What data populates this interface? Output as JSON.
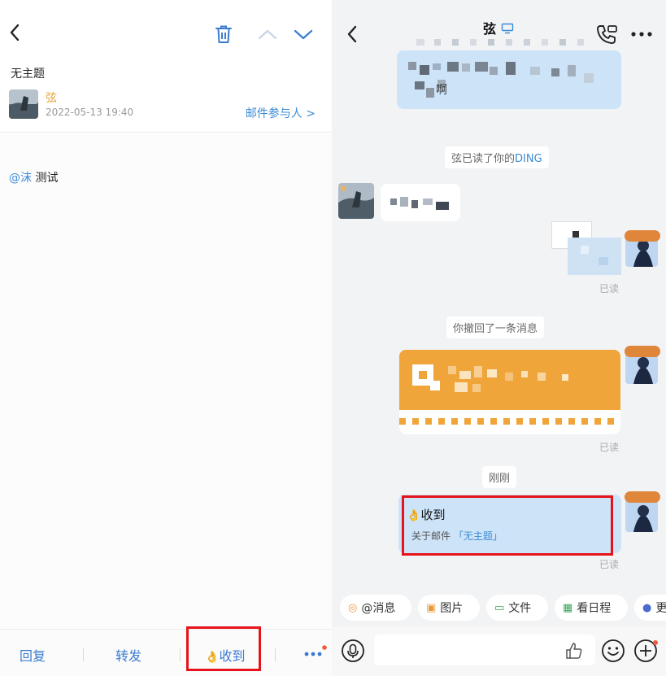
{
  "left": {
    "subject": "无主题",
    "sender": "弦",
    "date": "2022-05-13 19:40",
    "participants_link": "邮件参与人 >",
    "mention": "@沫",
    "mention_text": "测试",
    "bottom": {
      "reply": "回复",
      "forward": "转发",
      "received": "收到",
      "received_emoji": "👌"
    }
  },
  "right": {
    "title": "弦",
    "system_read_prefix": "弦已读了你的",
    "system_read_ding": "DING",
    "recalled": "你撤回了一条消息",
    "time": "刚刚",
    "read_label": "已读",
    "card": {
      "emoji": "👌",
      "title": "收到",
      "about_prefix": "关于邮件",
      "about_link": "「无主题」"
    },
    "quick_actions": [
      {
        "icon": "at-icon",
        "label": "@消息"
      },
      {
        "icon": "image-icon",
        "label": "图片"
      },
      {
        "icon": "folder-icon",
        "label": "文件"
      },
      {
        "icon": "calendar-icon",
        "label": "看日程"
      },
      {
        "icon": "more-icon",
        "label": "更"
      }
    ],
    "partial_chars": "啊"
  },
  "colors": {
    "accent_blue": "#3b8bd6",
    "sender_orange": "#e6a23c",
    "card_orange": "#f0a53a",
    "highlight_red": "#e6141a",
    "bubble_blue": "#cde3f8"
  }
}
